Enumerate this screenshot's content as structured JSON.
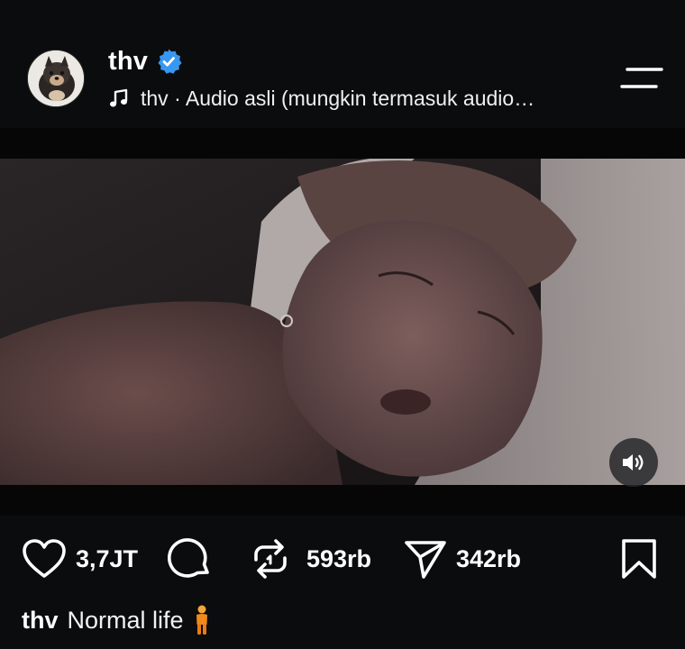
{
  "header": {
    "username": "thv",
    "verified": true,
    "audio_label": "thv · Audio asli (mungkin termasuk audio…",
    "icons": {
      "avatar": "dog-avatar",
      "verified": "verified-badge-icon",
      "music": "music-note-icon",
      "menu": "menu-icon"
    }
  },
  "video": {
    "icons": {
      "mute": "speaker-volume-icon"
    }
  },
  "actions": {
    "likes": "3,7JT",
    "reposts": "593rb",
    "shares": "342rb",
    "icons": {
      "like": "heart-icon",
      "comment": "comment-icon",
      "repost": "repost-icon",
      "share": "send-icon",
      "save": "bookmark-icon"
    }
  },
  "caption": {
    "username": "thv",
    "text": "Normal life",
    "emoji": "person-standing-emoji"
  },
  "colors": {
    "background": "#0b0c0e",
    "text": "#ffffff",
    "verified": "#3897f0"
  }
}
